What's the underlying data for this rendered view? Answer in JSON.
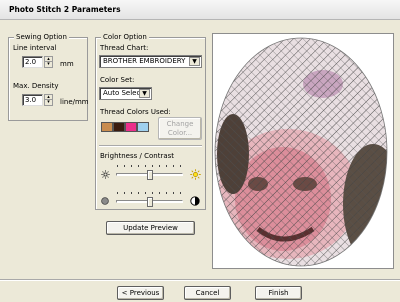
{
  "window": {
    "title": "Photo Stitch 2 Parameters"
  },
  "sewing_option": {
    "title": "Sewing Option",
    "line_interval_label": "Line interval",
    "line_interval_value": "2.0",
    "line_interval_unit": "mm",
    "max_density_label": "Max. Density",
    "max_density_value": "3.0",
    "max_density_unit": "line/mm"
  },
  "color_option": {
    "title": "Color Option",
    "thread_chart_label": "Thread Chart:",
    "thread_chart_value": "BROTHER EMBROIDERY",
    "color_set_label": "Color Set:",
    "color_set_value": "Auto Select",
    "thread_colors_label": "Thread Colors Used:",
    "thread_colors": [
      "#c98c4e",
      "#3a1c10",
      "#ec2f8a",
      "#9fd0ee"
    ],
    "change_color_button": [
      "Change",
      "Color..."
    ],
    "brightness_contrast_label": "Brightness / Contrast",
    "brightness_level": 0.5,
    "contrast_level": 0.5,
    "icons": [
      "brightness-low-icon",
      "brightness-high-icon",
      "contrast-low-icon",
      "contrast-high-icon"
    ]
  },
  "update_preview_button": "Update Preview",
  "footer": {
    "previous_button": "< Previous",
    "cancel_button": "Cancel",
    "finish_button": "Finish"
  },
  "preview": {
    "type": "cross-stitch photo preview (oval portrait of a smiling face)",
    "icon": "preview-image"
  }
}
